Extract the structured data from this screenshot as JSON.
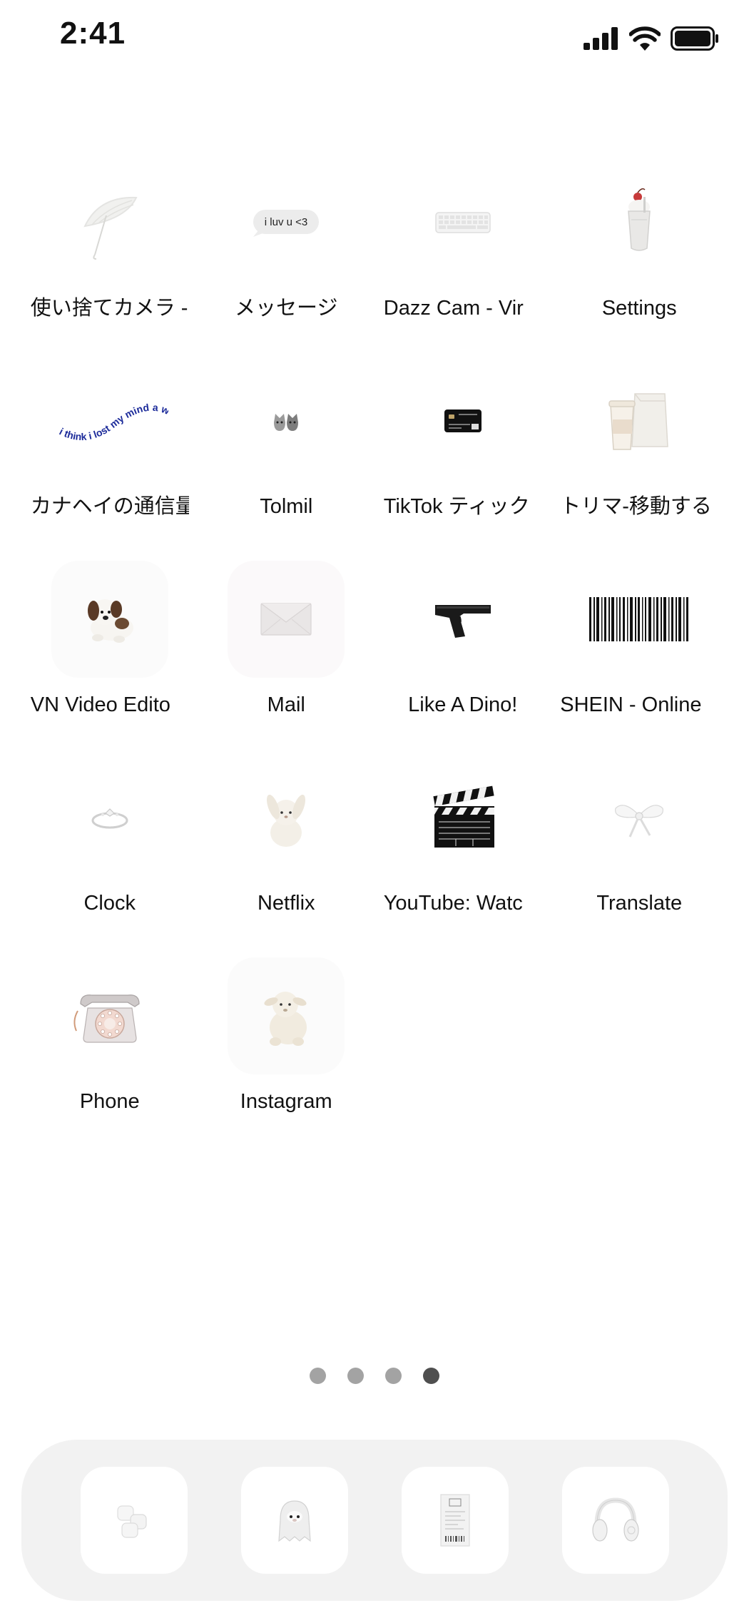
{
  "status_bar": {
    "time": "2:41"
  },
  "apps": [
    {
      "label": "使い捨てカメラ -",
      "icon": "umbrella-icon"
    },
    {
      "label": "メッセージ",
      "icon": "speech-bubble-icon",
      "icon_text": "i luv u <3"
    },
    {
      "label": "Dazz Cam - Vir",
      "icon": "keyboard-icon"
    },
    {
      "label": "Settings",
      "icon": "milkshake-icon"
    },
    {
      "label": "カナヘイの通信量",
      "icon": "wavy-text-icon",
      "icon_text": "i think i lost my mind a while ago"
    },
    {
      "label": "Tolmil",
      "icon": "cat-icon"
    },
    {
      "label": "TikTok ティック",
      "icon": "credit-card-icon"
    },
    {
      "label": "トリマ-移動する",
      "icon": "coffee-bag-icon"
    },
    {
      "label": "VN Video Edito",
      "icon": "plush-dog-icon"
    },
    {
      "label": "Mail",
      "icon": "envelope-icon"
    },
    {
      "label": "Like A Dino!",
      "icon": "pistol-icon"
    },
    {
      "label": "SHEIN - Online",
      "icon": "barcode-icon"
    },
    {
      "label": "Clock",
      "icon": "ring-icon"
    },
    {
      "label": "Netflix",
      "icon": "plush-bunny-icon"
    },
    {
      "label": "YouTube: Watc",
      "icon": "clapperboard-icon"
    },
    {
      "label": "Translate",
      "icon": "ribbon-bow-icon"
    },
    {
      "label": "Phone",
      "icon": "rotary-phone-icon"
    },
    {
      "label": "Instagram",
      "icon": "plush-lamb-icon"
    }
  ],
  "page_dots": {
    "count": 4,
    "active_index": 3
  },
  "dock": [
    {
      "icon": "marshmallows-icon"
    },
    {
      "icon": "ghost-icon"
    },
    {
      "icon": "receipt-icon"
    },
    {
      "icon": "headphones-icon"
    }
  ],
  "colors": {
    "background": "#ffffff",
    "dock_background": "#f2f2f2",
    "dot_inactive": "#a3a3a3",
    "dot_active": "#4f4f4f"
  }
}
